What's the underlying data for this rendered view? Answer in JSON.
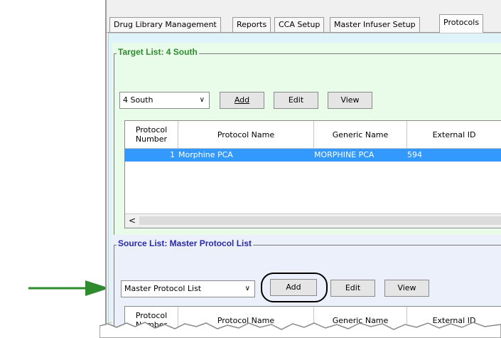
{
  "tabs": [
    {
      "label": "Drug Library Management"
    },
    {
      "label": "Reports"
    },
    {
      "label": "CCA Setup"
    },
    {
      "label": "Master Infuser Setup"
    },
    {
      "label": "Protocols"
    }
  ],
  "target": {
    "title": "Target List: 4 South",
    "dropdown_value": "4 South",
    "buttons": {
      "add": "Add",
      "edit": "Edit",
      "view": "View"
    },
    "columns": [
      "Protocol Number",
      "Protocol Name",
      "Generic Name",
      "External ID"
    ],
    "rows": [
      {
        "number": "1",
        "name": "Morphine PCA",
        "generic": "MORPHINE PCA",
        "external_id": "594"
      }
    ],
    "scroll_left": "<"
  },
  "source": {
    "title": "Source List: Master Protocol List",
    "dropdown_value": "Master Protocol List",
    "buttons": {
      "add": "Add",
      "edit": "Edit",
      "view": "View"
    },
    "columns": [
      "Protocol Number",
      "Protocol Name",
      "Generic Name",
      "External ID"
    ]
  },
  "colors": {
    "target_title": "#2e8b2e",
    "source_title": "#2a2aa8",
    "arrow": "#2e8b2e",
    "selection": "#3399ff"
  }
}
